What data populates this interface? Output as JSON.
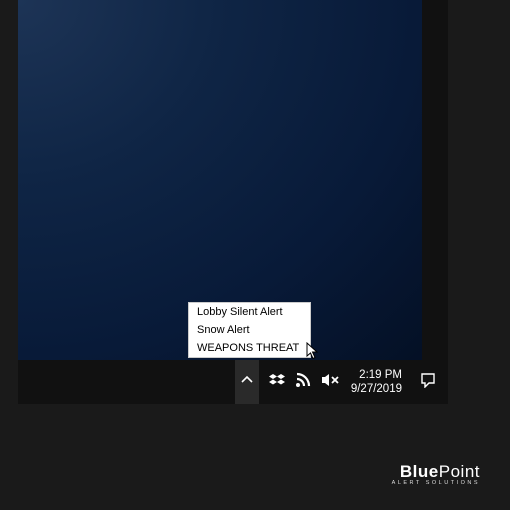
{
  "menu": {
    "items": [
      {
        "label": "Lobby Silent Alert"
      },
      {
        "label": "Snow Alert"
      },
      {
        "label": "WEAPONS THREAT"
      }
    ]
  },
  "taskbar": {
    "time": "2:19 PM",
    "date": "9/27/2019"
  },
  "brand": {
    "word1": "Blue",
    "word2": "Point",
    "subtitle": "ALERT SOLUTIONS"
  },
  "icons": {
    "tray_up": "chevron-up-icon",
    "dropbox": "dropbox-icon",
    "wifi": "wifi-rss-icon",
    "volume": "volume-muted-icon",
    "notifications": "notification-center-icon"
  }
}
